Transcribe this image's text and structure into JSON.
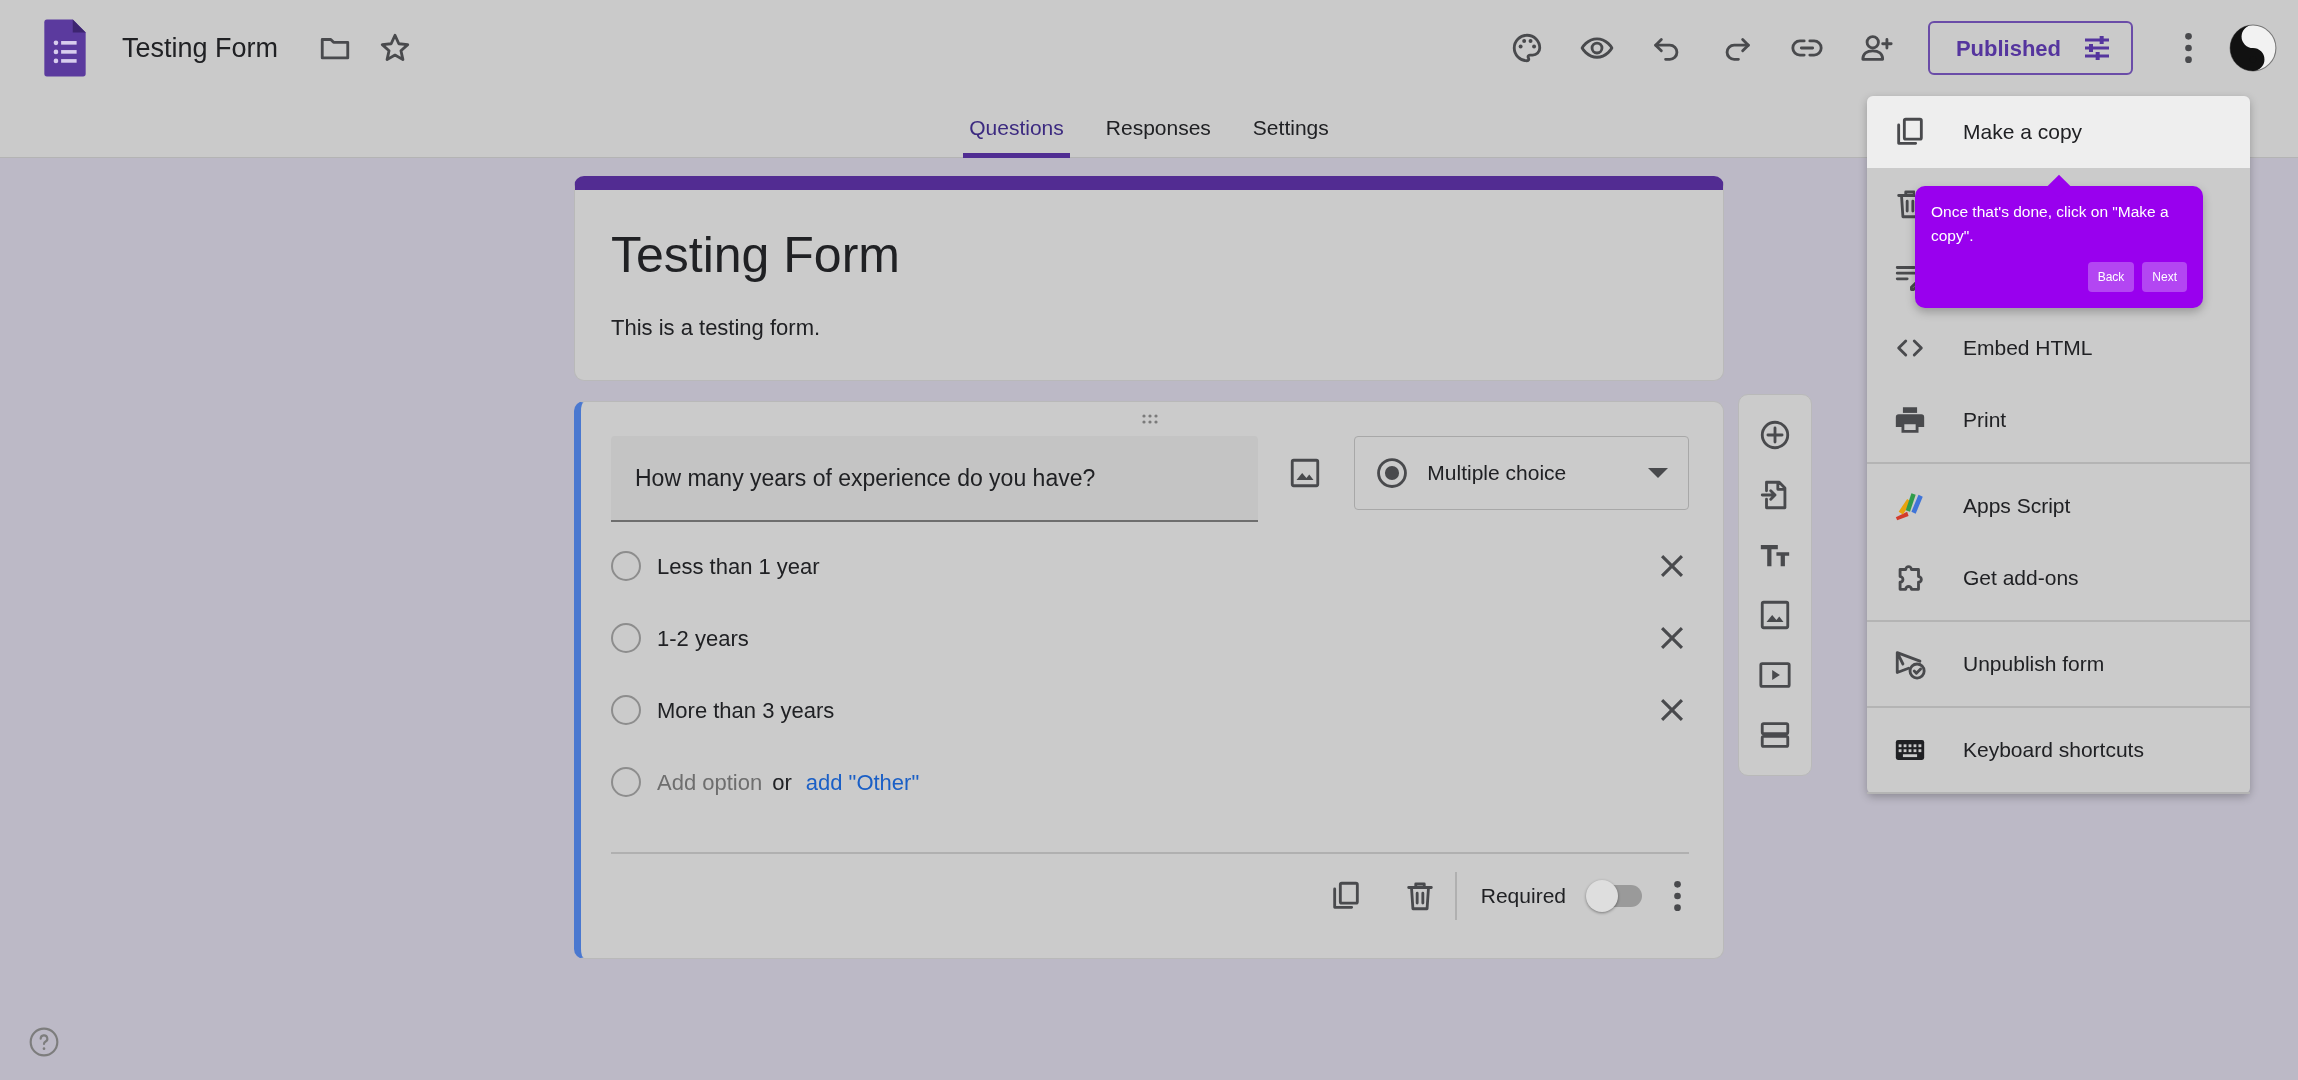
{
  "app": {
    "title": "Testing Form"
  },
  "publish_button": {
    "label": "Published"
  },
  "tabs": [
    {
      "label": "Questions",
      "selected": true
    },
    {
      "label": "Responses",
      "selected": false
    },
    {
      "label": "Settings",
      "selected": false
    }
  ],
  "form_header": {
    "title": "Testing Form",
    "description": "This is a testing form."
  },
  "question": {
    "text": "How many years of experience do you have?",
    "type": "Multiple choice",
    "options": [
      {
        "label": "Less than 1 year",
        "selected": false
      },
      {
        "label": "1-2 years",
        "selected": false
      },
      {
        "label": "More than 3 years",
        "selected": false
      }
    ],
    "add_option": {
      "placeholder": "Add option",
      "connector": "or",
      "other_link": "add \"Other\"",
      "selected": false
    },
    "required_label": "Required",
    "required": false
  },
  "menu": {
    "sections": [
      [
        {
          "kind": "copy",
          "label": "Make a copy",
          "selected": true
        },
        {
          "kind": "delete",
          "selected": false
        },
        {
          "kind": "prefill",
          "selected": false
        },
        {
          "kind": "embed",
          "label": "Embed HTML",
          "selected": false
        },
        {
          "kind": "print",
          "label": "Print",
          "selected": false
        }
      ],
      [
        {
          "kind": "script",
          "label": "Apps Script",
          "selected": false
        },
        {
          "kind": "addons",
          "label": "Get add-ons",
          "selected": false
        }
      ],
      [
        {
          "kind": "unpublish",
          "label": "Unpublish form",
          "selected": false
        }
      ],
      [
        {
          "kind": "keyboard",
          "label": "Keyboard shortcuts",
          "selected": false
        }
      ]
    ]
  },
  "tooltip": {
    "text": "Once that's done, click on \"Make a copy\".",
    "buttons": [
      "Back",
      "Next"
    ]
  }
}
